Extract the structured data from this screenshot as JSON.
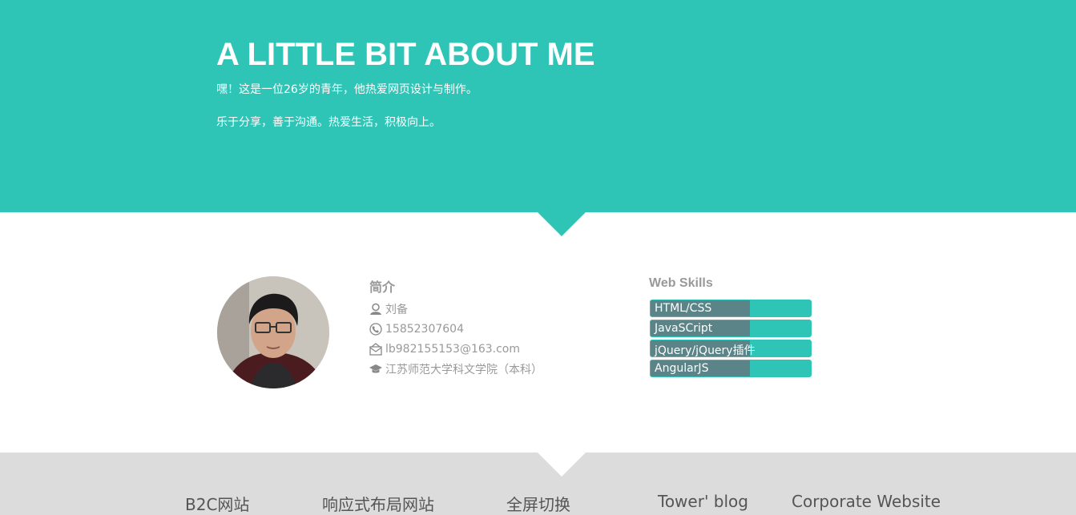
{
  "hero": {
    "title": "A LITTLE BIT ABOUT ME",
    "line1": "嘿！这是一位26岁的青年，他热爱网页设计与制作。",
    "line2": "乐于分享，善于沟通。热爱生活，积极向上。"
  },
  "profile": {
    "avatar_icon": "person-photo",
    "intro_title": "简介",
    "items": [
      {
        "icon": "user-icon",
        "text": "刘备"
      },
      {
        "icon": "phone-icon",
        "text": "15852307604"
      },
      {
        "icon": "envelope-icon",
        "text": "lb982155153@163.com"
      },
      {
        "icon": "graduation-cap-icon",
        "text": "江苏师范大学科文学院（本科）"
      }
    ]
  },
  "skills": {
    "title": "Web Skills",
    "items": [
      {
        "label": "HTML/CSS",
        "level": 0.62
      },
      {
        "label": "JavaSCript",
        "level": 0.62
      },
      {
        "label": "jQuery/jQuery插件",
        "level": 0.62
      },
      {
        "label": "AngularJS",
        "level": 0.62
      }
    ]
  },
  "footer": {
    "links": [
      "B2C网站",
      "响应式布局网站",
      "全屏切换",
      "Tower' blog",
      "Corporate Website"
    ]
  },
  "colors": {
    "accent": "#2ec4b6",
    "skill_fill": "#5a8487",
    "footer_bg": "#dcdcdc"
  }
}
